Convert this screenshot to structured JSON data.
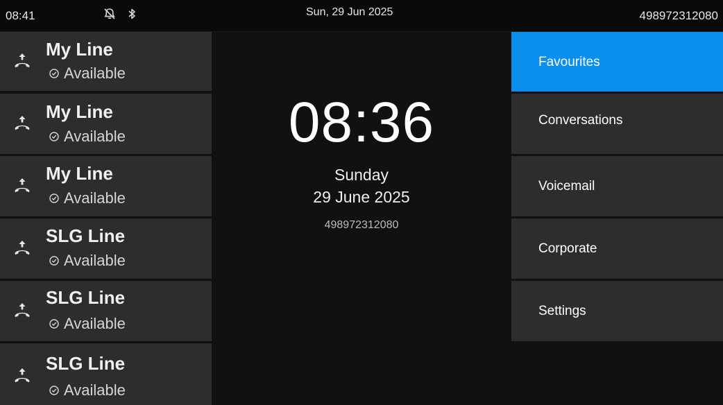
{
  "status_bar": {
    "time": "08:41",
    "date": "Sun, 29 Jun 2025",
    "number": "498972312080",
    "icons": [
      "bell-off-icon",
      "bluetooth-icon"
    ]
  },
  "lines": [
    {
      "name": "My Line",
      "status": "Available",
      "icon": "line-call-icon",
      "status_icon": "availability-icon"
    },
    {
      "name": "My Line",
      "status": "Available",
      "icon": "line-call-icon",
      "status_icon": "availability-icon"
    },
    {
      "name": "My Line",
      "status": "Available",
      "icon": "line-call-icon",
      "status_icon": "availability-icon"
    },
    {
      "name": "SLG Line",
      "status": "Available",
      "icon": "line-call-icon",
      "status_icon": "availability-icon"
    },
    {
      "name": "SLG Line",
      "status": "Available",
      "icon": "line-call-icon",
      "status_icon": "availability-icon"
    },
    {
      "name": "SLG Line",
      "status": "Available",
      "icon": "line-call-icon",
      "status_icon": "availability-icon"
    }
  ],
  "center": {
    "clock": "08:36",
    "day": "Sunday",
    "date": "29 June 2025",
    "number": "498972312080"
  },
  "menu": {
    "items": [
      {
        "label": "Favourites",
        "active": true
      },
      {
        "label": "Conversations",
        "active": false
      },
      {
        "label": "Voicemail",
        "active": false
      },
      {
        "label": "Corporate",
        "active": false
      },
      {
        "label": "Settings",
        "active": false
      }
    ]
  },
  "colors": {
    "accent": "#0a8fef",
    "tile": "#2d2d2d",
    "background": "#111111"
  }
}
